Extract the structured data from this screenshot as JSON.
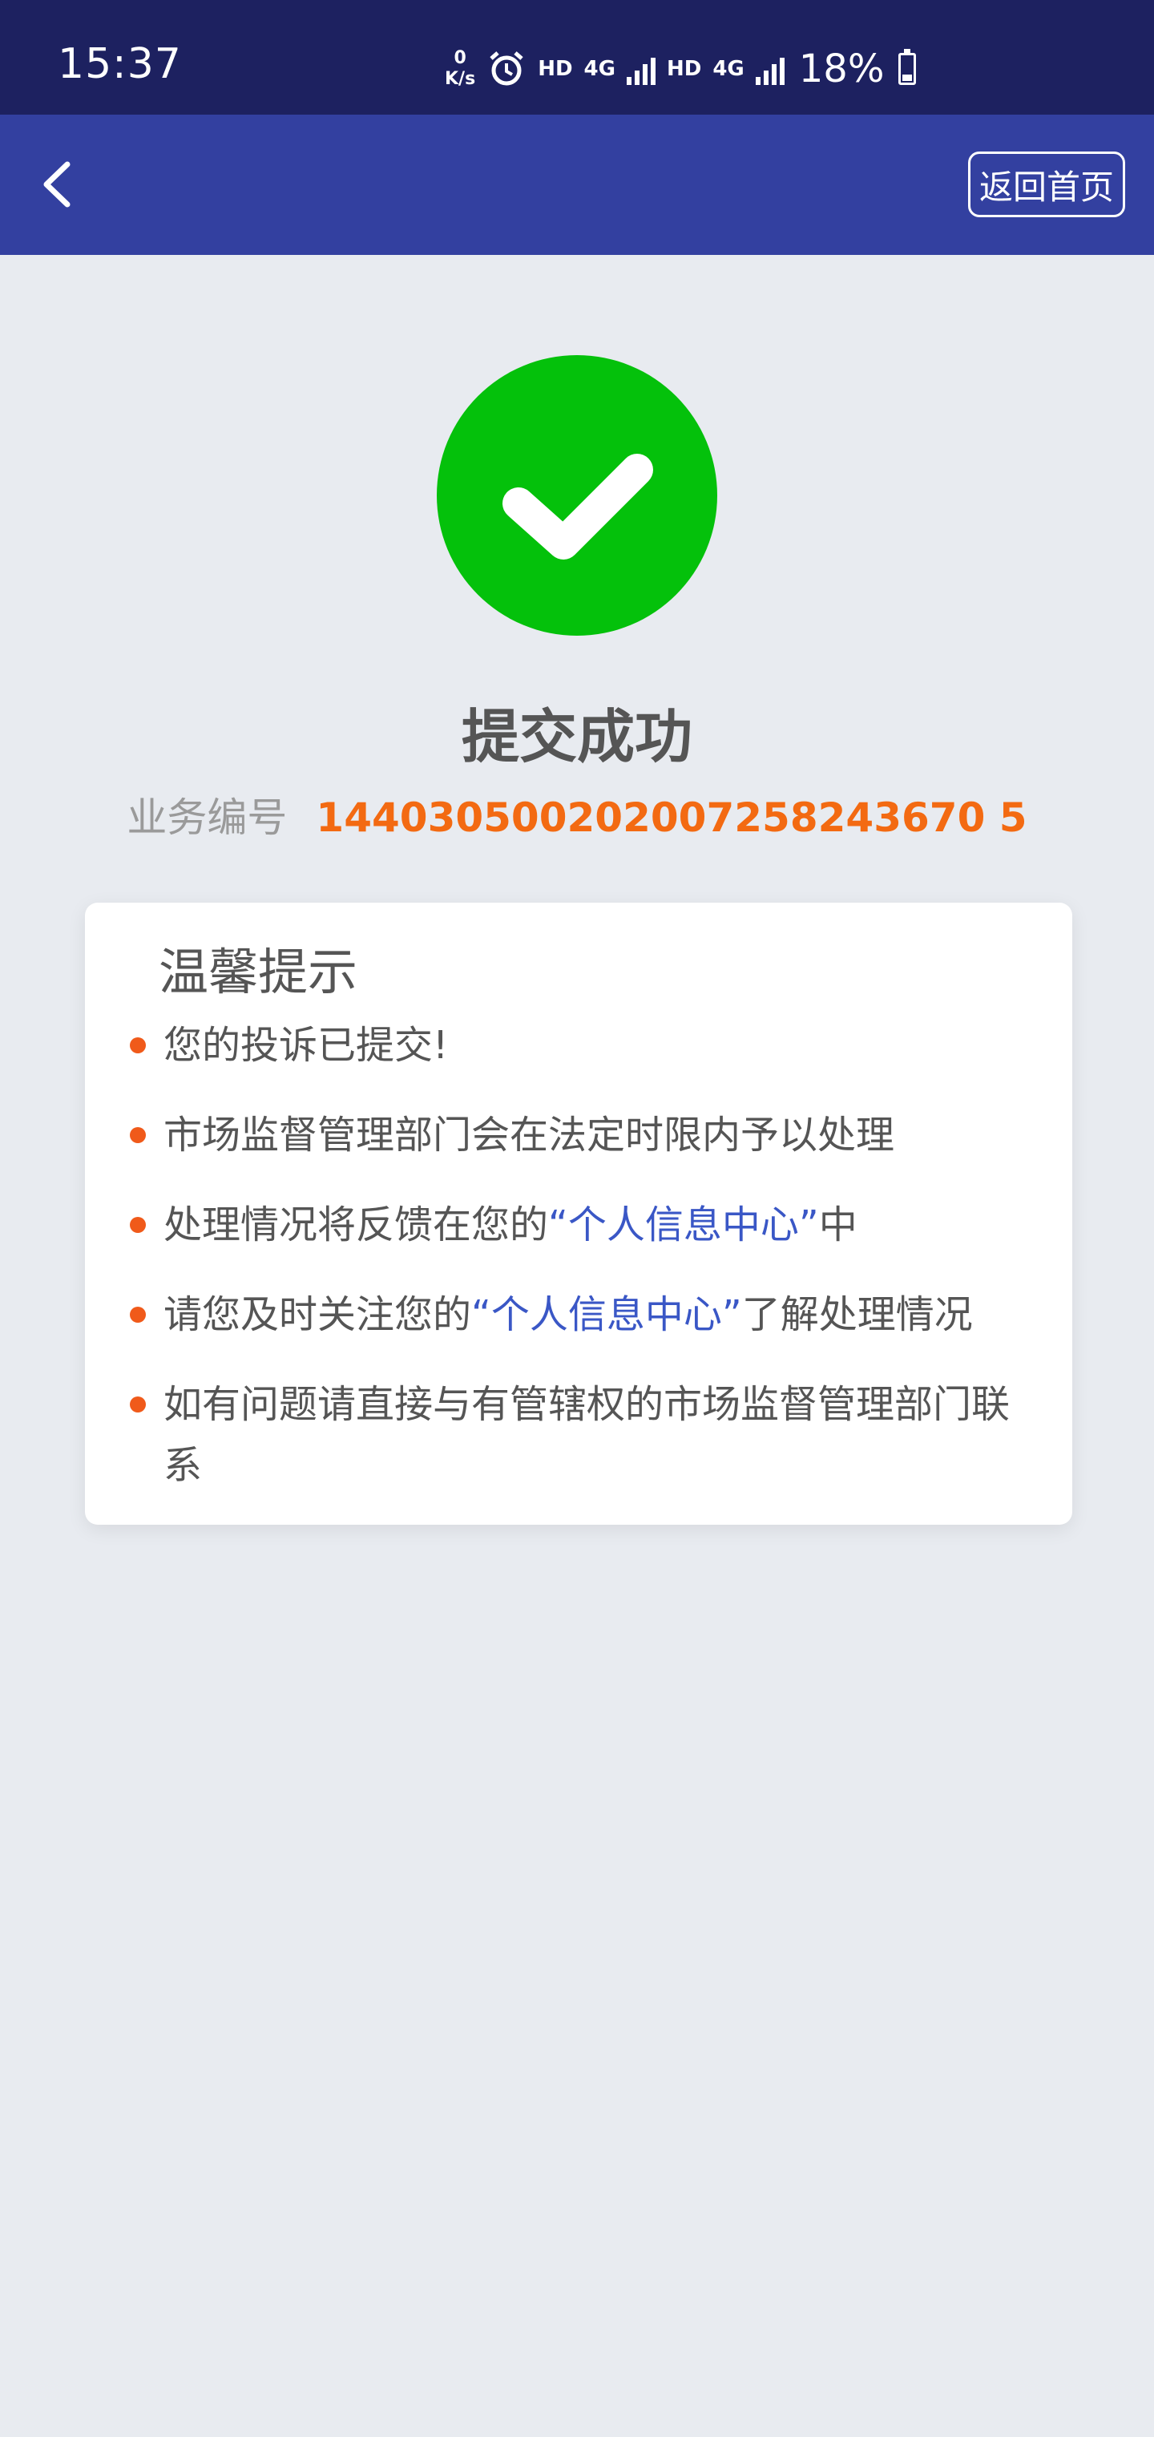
{
  "statusbar": {
    "time": "15:37",
    "speed_value": "0",
    "speed_unit": "K/s",
    "hd1": "HD",
    "net1": "4G",
    "hd2": "HD",
    "net2": "4G",
    "battery": "18%"
  },
  "nav": {
    "home_label": "返回首页"
  },
  "result": {
    "title": "提交成功",
    "bizno_label": "业务编号",
    "bizno_value": "144030500202007258243670 5"
  },
  "tips": {
    "title": "温馨提示",
    "item1": "您的投诉已提交!",
    "item2": "市场监督管理部门会在法定时限内予以处理",
    "item3_pre": "处理情况将反馈在您的",
    "item3_link": "“个人信息中心”",
    "item3_post": "中",
    "item4_pre": "请您及时关注您的",
    "item4_link": "“个人信息中心”",
    "item4_post": "了解处理情况",
    "item5": "如有问题请直接与有管辖权的市场监督管理部门联系"
  },
  "colors": {
    "status_bg": "#1d2160",
    "nav_bg": "#3340a0",
    "success_green": "#04c10b",
    "accent_orange": "#f36a12",
    "link_blue": "#3a57c6"
  }
}
